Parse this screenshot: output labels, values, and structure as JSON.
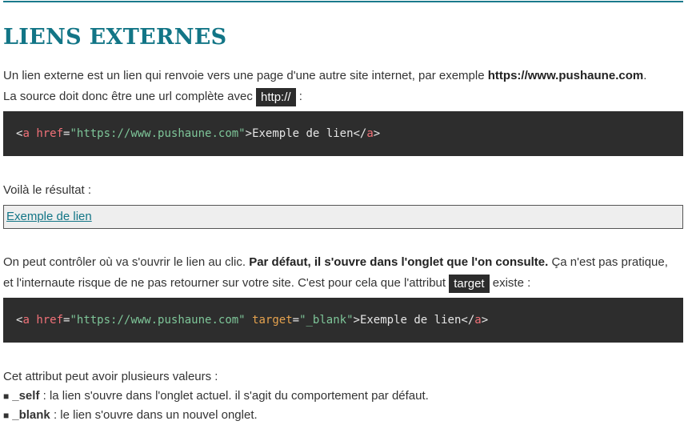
{
  "section": {
    "title": "LIENS EXTERNES"
  },
  "intro": {
    "line1_text": "Un lien externe est un lien qui renvoie vers une page d'une autre site internet, par exemple ",
    "line1_bold": "https://www.pushaune.com",
    "line1_end": ".",
    "line2_text": "La source doit donc être une url complète avec ",
    "line2_code": "http://",
    "line2_end": " :"
  },
  "code1": {
    "open_lt": "<",
    "tag": "a",
    "attr_href": "href",
    "eq": "=",
    "href_value": "\"https://www.pushaune.com\"",
    "close_gt": ">",
    "text": "Exemple de lien",
    "end_open": "</",
    "end_tag": "a",
    "end_close": ">"
  },
  "result": {
    "label": "Voilà le résultat :",
    "link_text": "Exemple de lien"
  },
  "target_para": {
    "text1": "On peut contrôler où va s'ouvrir le lien au clic. ",
    "bold": "Par défaut, il s'ouvre dans l'onglet que l'on consulte.",
    "text2": " Ça n'est pas pratique,",
    "line2_text": "et l'internaute risque de ne pas retourner sur votre site. C'est pour cela que l'attribut ",
    "line2_code": "target",
    "line2_end": " existe :"
  },
  "code2": {
    "open_lt": "<",
    "tag": "a",
    "attr_href": "href",
    "eq": "=",
    "href_value": "\"https://www.pushaune.com\"",
    "space": " ",
    "attr_target": "target",
    "target_value": "\"_blank\"",
    "close_gt": ">",
    "text": "Exemple de lien",
    "end_open": "</",
    "end_tag": "a",
    "end_close": ">"
  },
  "values_list": {
    "intro": "Cet attribut peut avoir plusieurs valeurs :",
    "bullet": "■",
    "items": [
      {
        "name": "_self",
        "desc": " : la lien s'ouvre dans l'onglet actuel. il s'agit du comportement par défaut."
      },
      {
        "name": "_blank",
        "desc": " : le lien s'ouvre dans un nouvel onglet."
      }
    ]
  }
}
